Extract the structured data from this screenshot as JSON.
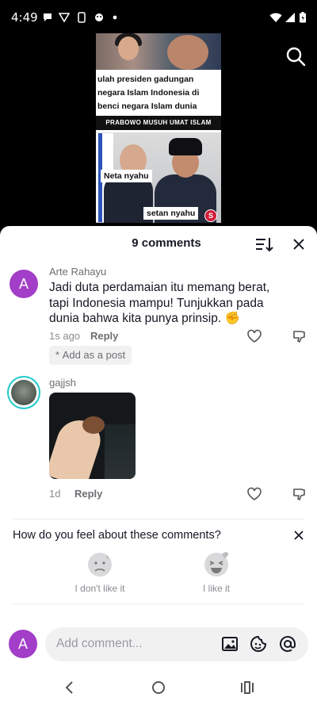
{
  "status": {
    "time": "4:49"
  },
  "video": {
    "headline": "ulah presiden gadungan negara Islam Indonesia di benci negara Islam dunia",
    "banner": "PRABOWO MUSUH UMAT ISLAM",
    "label_left": "Neta nyahu",
    "label_right": "setan nyahu",
    "badge": "S"
  },
  "comments": {
    "title": "9 comments",
    "items": [
      {
        "username": "Arte Rahayu",
        "avatar_letter": "A",
        "text": "Jadi duta perdamaian itu memang berat, tapi Indonesia mampu! Tunjukkan pada dunia bahwa kita punya prinsip. ✊",
        "time": "1s ago",
        "reply": "Reply",
        "add_post": "Add as a post"
      },
      {
        "username": "gajjsh",
        "time": "1d",
        "reply": "Reply"
      }
    ]
  },
  "feedback": {
    "question": "How do you feel about these comments?",
    "dislike": "I don't like it",
    "like": "I like it"
  },
  "input": {
    "avatar_letter": "A",
    "placeholder": "Add comment..."
  },
  "colors": {
    "avatar": "#a23ec7",
    "ring": "#21c9c9"
  }
}
